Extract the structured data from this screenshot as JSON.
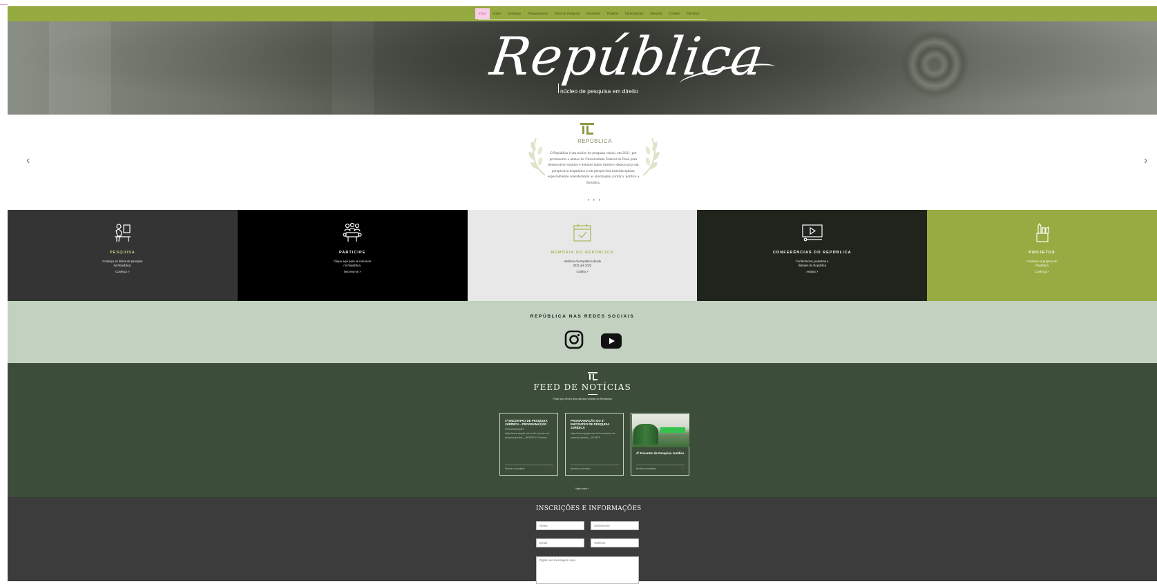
{
  "nav": {
    "items": [
      "Início",
      "Sobre",
      "Destaque",
      "Pesquisadores",
      "Eixos de Pesquisa",
      "Inscrições",
      "Projetos",
      "Participações",
      "Memória",
      "Contato",
      "Parceiros"
    ]
  },
  "hero": {
    "title": "República",
    "subtitle": "núcleo de pesquisa em direito"
  },
  "slider": {
    "logo_word": "REPÚBLICA",
    "description": "O República é um núcleo de pesquisa criado, em 2021, por professores e alunos da Universidade Federal do Piauí para desenvolver estudos e debates sobre direito e democracia em perspectiva dogmática e em perspectiva interdisciplinar, especialmente considerando as abordagens jurídica, política e filosófica.",
    "prev": "‹",
    "next": "›",
    "dots": "• • •"
  },
  "cards": [
    {
      "title": "PESQUISA",
      "text": "Conheça as linhas de pesquisa do República.",
      "link": "Conheça >",
      "icon": "desk-user-icon"
    },
    {
      "title": "PARTICIPE",
      "text": "Clique aqui para se inscrever no República.",
      "link": "Inscreva-se >",
      "icon": "meeting-group-icon"
    },
    {
      "title": "MEMÓRIA DO REPÚBLICA",
      "text": "Histórico do República desde 2021 até 2022",
      "link": "Confira >",
      "icon": "calendar-check-icon"
    },
    {
      "title": "CONFERÊNCIAS DO REPÚBLICA",
      "text": "Conferências, palestras e debates do República",
      "link": "Assista >",
      "icon": "video-player-icon"
    },
    {
      "title": "PROJETOS",
      "text": "Conheça os projetos do República",
      "link": "Conheça >",
      "icon": "pencil-cup-icon"
    }
  ],
  "social": {
    "title": "REPÚBLICA NAS REDES SOCIAIS",
    "icons": [
      "instagram-icon",
      "youtube-icon"
    ]
  },
  "feed": {
    "title": "FEED DE NOTÍCIAS",
    "tagline": "Fique por dentro das últimas notícias do República",
    "posts": [
      {
        "title": "4º ENCONTRO DE PESQUISA JURÍDICA - PROGRAMAÇÃO",
        "body": "PROGRAMAÇÃO https://www.sympla.com.br/4o-encontro-de-pesquisa-juridica__1876878 4º Encontro...",
        "footer": "Nenhum comentário"
      },
      {
        "title": "PROGRAMAÇÃO DO 4º ENCONTRO DE PESQUISA JURÍDICA",
        "body": "https://www.sympla.com.br/4o-encontro-de-pesquisa-juridica__1876878",
        "footer": "Nenhum comentário"
      },
      {
        "title": "4º Encontro de Pesquisa Jurídica",
        "body": "",
        "footer": "Nenhum comentário"
      }
    ],
    "more": "Veja mais >"
  },
  "contact": {
    "title": "INSCRIÇÕES E INFORMAÇÕES",
    "fields": {
      "first_name": "Nome",
      "last_name": "Sobrenome",
      "email": "Email",
      "phone": "Telefone",
      "message": "Digite sua mensagem aqui"
    }
  },
  "colors": {
    "nav_green": "#95aa40",
    "accent_pink": "#d0388e",
    "feed_green": "#3c4e3a",
    "social_sage": "#c2d1c0",
    "contact_dark": "#3c3c3c"
  }
}
